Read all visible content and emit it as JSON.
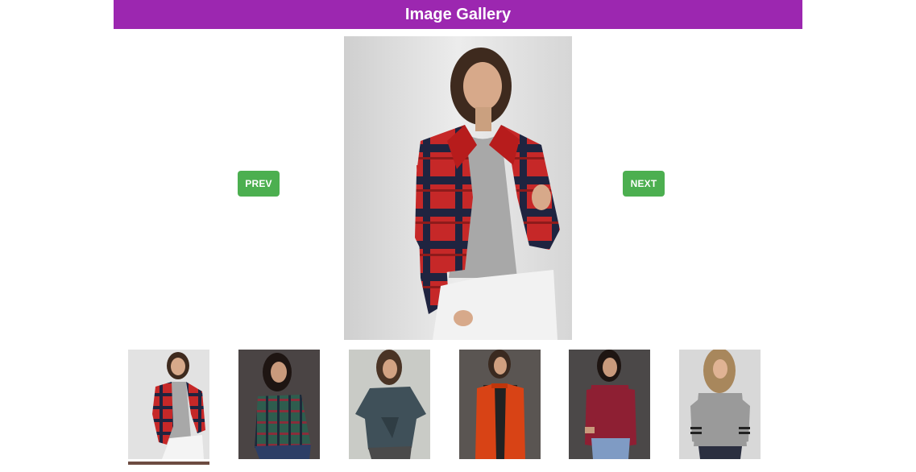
{
  "header": {
    "title": "Image Gallery"
  },
  "nav": {
    "prev_label": "PREV",
    "next_label": "NEXT"
  },
  "colors": {
    "header_bg": "#9c27b0",
    "button_bg": "#4caf50",
    "active_indicator": "#6d4c41"
  },
  "main_image": {
    "icon": "photo-model-red-plaid-jacket"
  },
  "thumbnails": [
    {
      "icon": "photo-red-plaid-jacket",
      "active": true
    },
    {
      "icon": "photo-green-plaid-shirt",
      "active": false
    },
    {
      "icon": "photo-grey-tie-front-top",
      "active": false
    },
    {
      "icon": "photo-orange-puffer-vest",
      "active": false
    },
    {
      "icon": "photo-maroon-cutout-top",
      "active": false
    },
    {
      "icon": "photo-grey-striped-sweater",
      "active": false
    }
  ]
}
